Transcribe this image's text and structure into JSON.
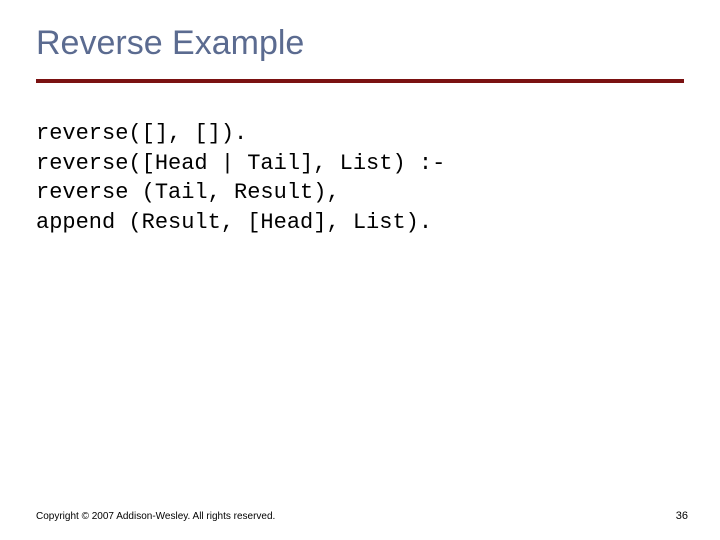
{
  "title": "Reverse Example",
  "code": "reverse([], []).\nreverse([Head | Tail], List) :-\nreverse (Tail, Result),\nappend (Result, [Head], List).",
  "footer": "Copyright © 2007 Addison-Wesley. All rights reserved.",
  "page_number": "36"
}
